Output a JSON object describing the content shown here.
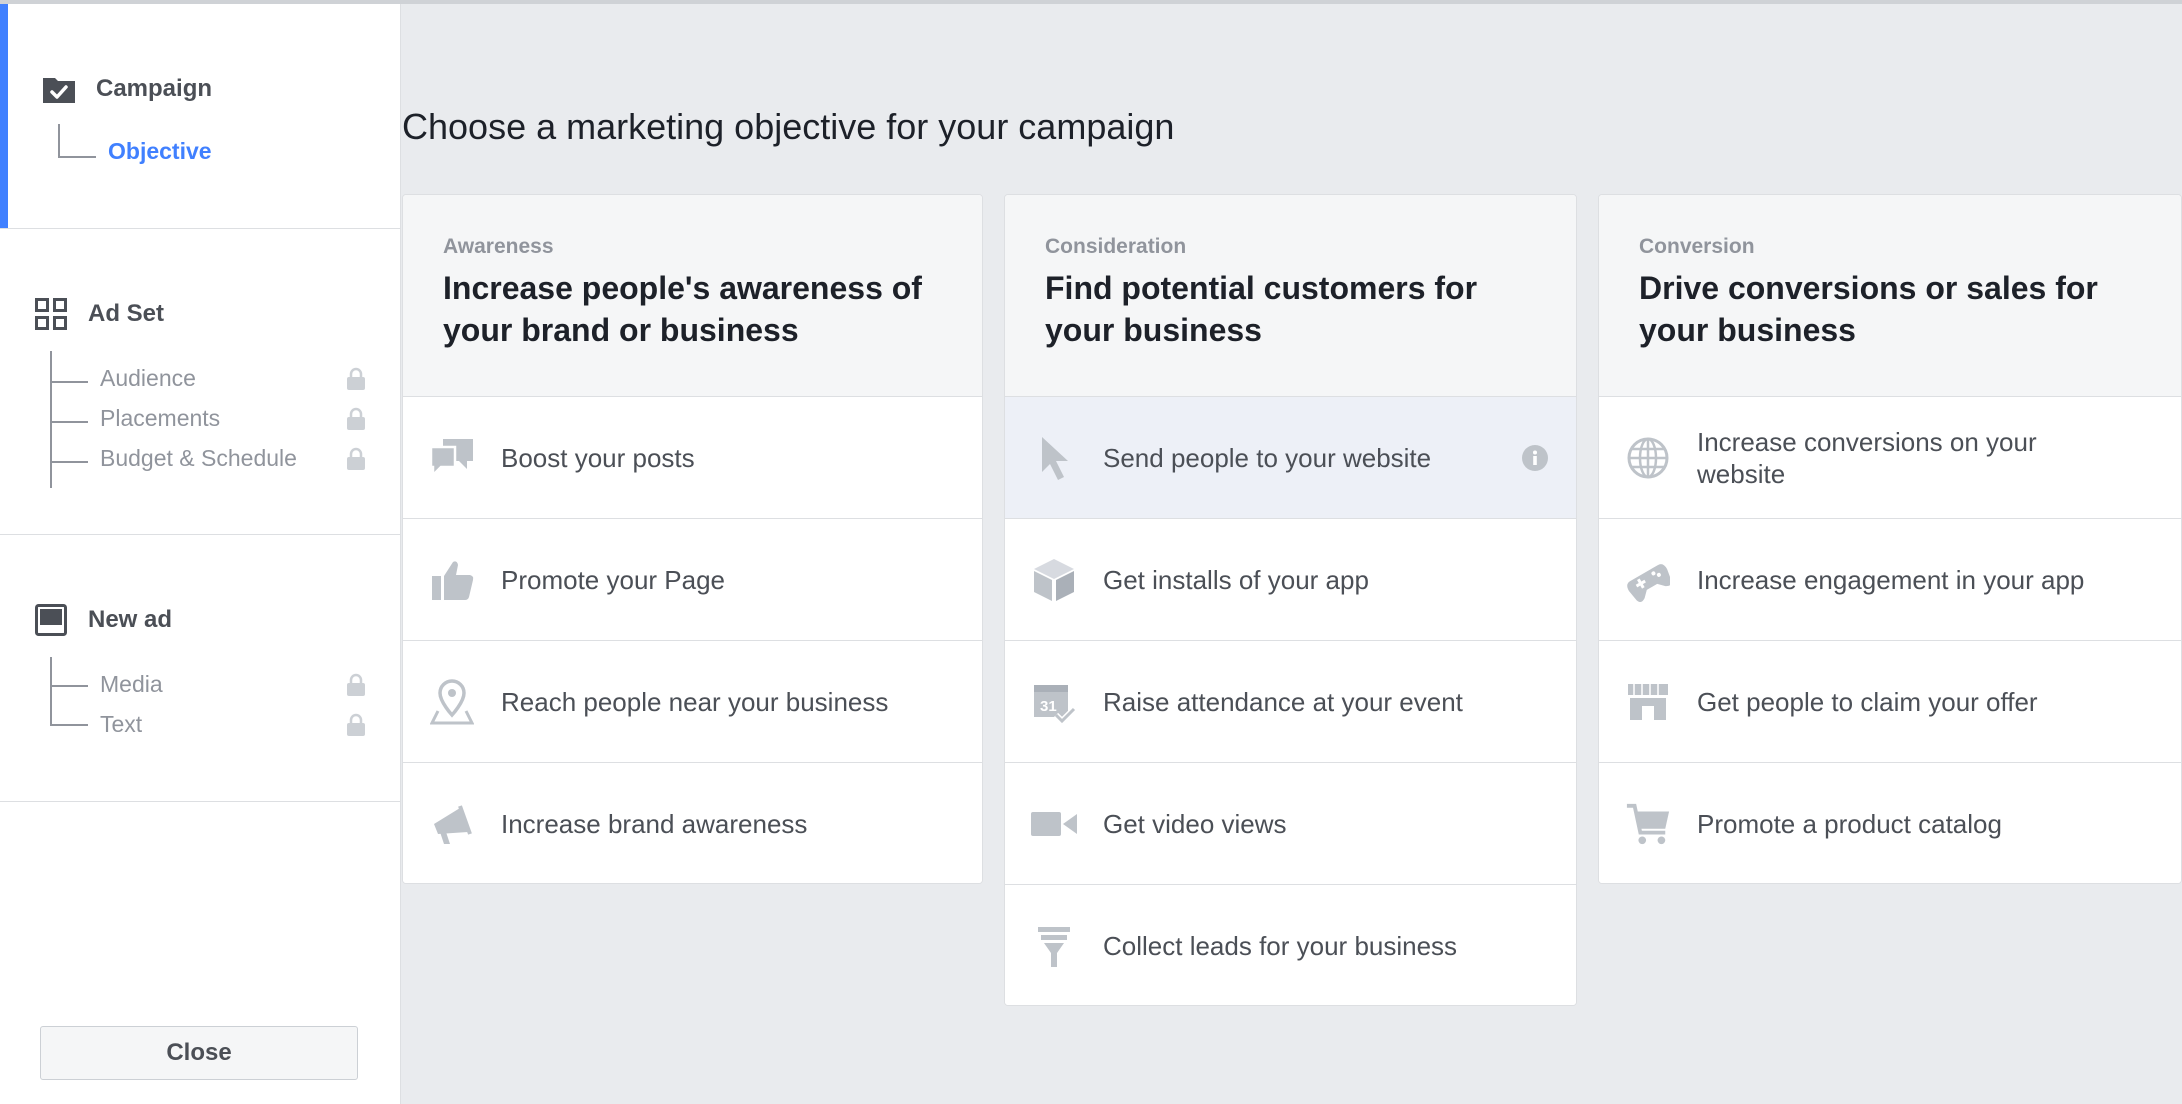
{
  "sidebar": {
    "campaign": {
      "title": "Campaign",
      "items": [
        {
          "label": "Objective"
        }
      ]
    },
    "ad_set": {
      "title": "Ad Set",
      "items": [
        {
          "label": "Audience"
        },
        {
          "label": "Placements"
        },
        {
          "label": "Budget & Schedule"
        }
      ]
    },
    "new_ad": {
      "title": "New ad",
      "items": [
        {
          "label": "Media"
        },
        {
          "label": "Text"
        }
      ]
    },
    "close_label": "Close"
  },
  "main": {
    "title": "Choose a marketing objective for your campaign",
    "columns": [
      {
        "category": "Awareness",
        "heading": "Increase people's awareness of your brand or business",
        "options": [
          {
            "label": "Boost your posts",
            "icon": "speech-bubbles-icon"
          },
          {
            "label": "Promote your Page",
            "icon": "thumbs-up-icon"
          },
          {
            "label": "Reach people near your business",
            "icon": "map-pin-icon"
          },
          {
            "label": "Increase brand awareness",
            "icon": "megaphone-icon"
          }
        ]
      },
      {
        "category": "Consideration",
        "heading": "Find potential customers for your business",
        "options": [
          {
            "label": "Send people to your website",
            "icon": "cursor-icon"
          },
          {
            "label": "Get installs of your app",
            "icon": "box-icon"
          },
          {
            "label": "Raise attendance at your event",
            "icon": "calendar-icon"
          },
          {
            "label": "Get video views",
            "icon": "video-camera-icon"
          },
          {
            "label": "Collect leads for your business",
            "icon": "funnel-icon"
          }
        ]
      },
      {
        "category": "Conversion",
        "heading": "Drive conversions or sales for your business",
        "options": [
          {
            "label": "Increase conversions on your website",
            "icon": "globe-icon"
          },
          {
            "label": "Increase engagement in your app",
            "icon": "gamepad-icon"
          },
          {
            "label": "Get people to claim your offer",
            "icon": "storefront-icon"
          },
          {
            "label": "Promote a product catalog",
            "icon": "shopping-cart-icon"
          }
        ]
      }
    ]
  },
  "colors": {
    "accent": "#4080ff",
    "icon": "#bec3c9",
    "hover_row": "#edf0f7",
    "background": "#e9ebee"
  }
}
